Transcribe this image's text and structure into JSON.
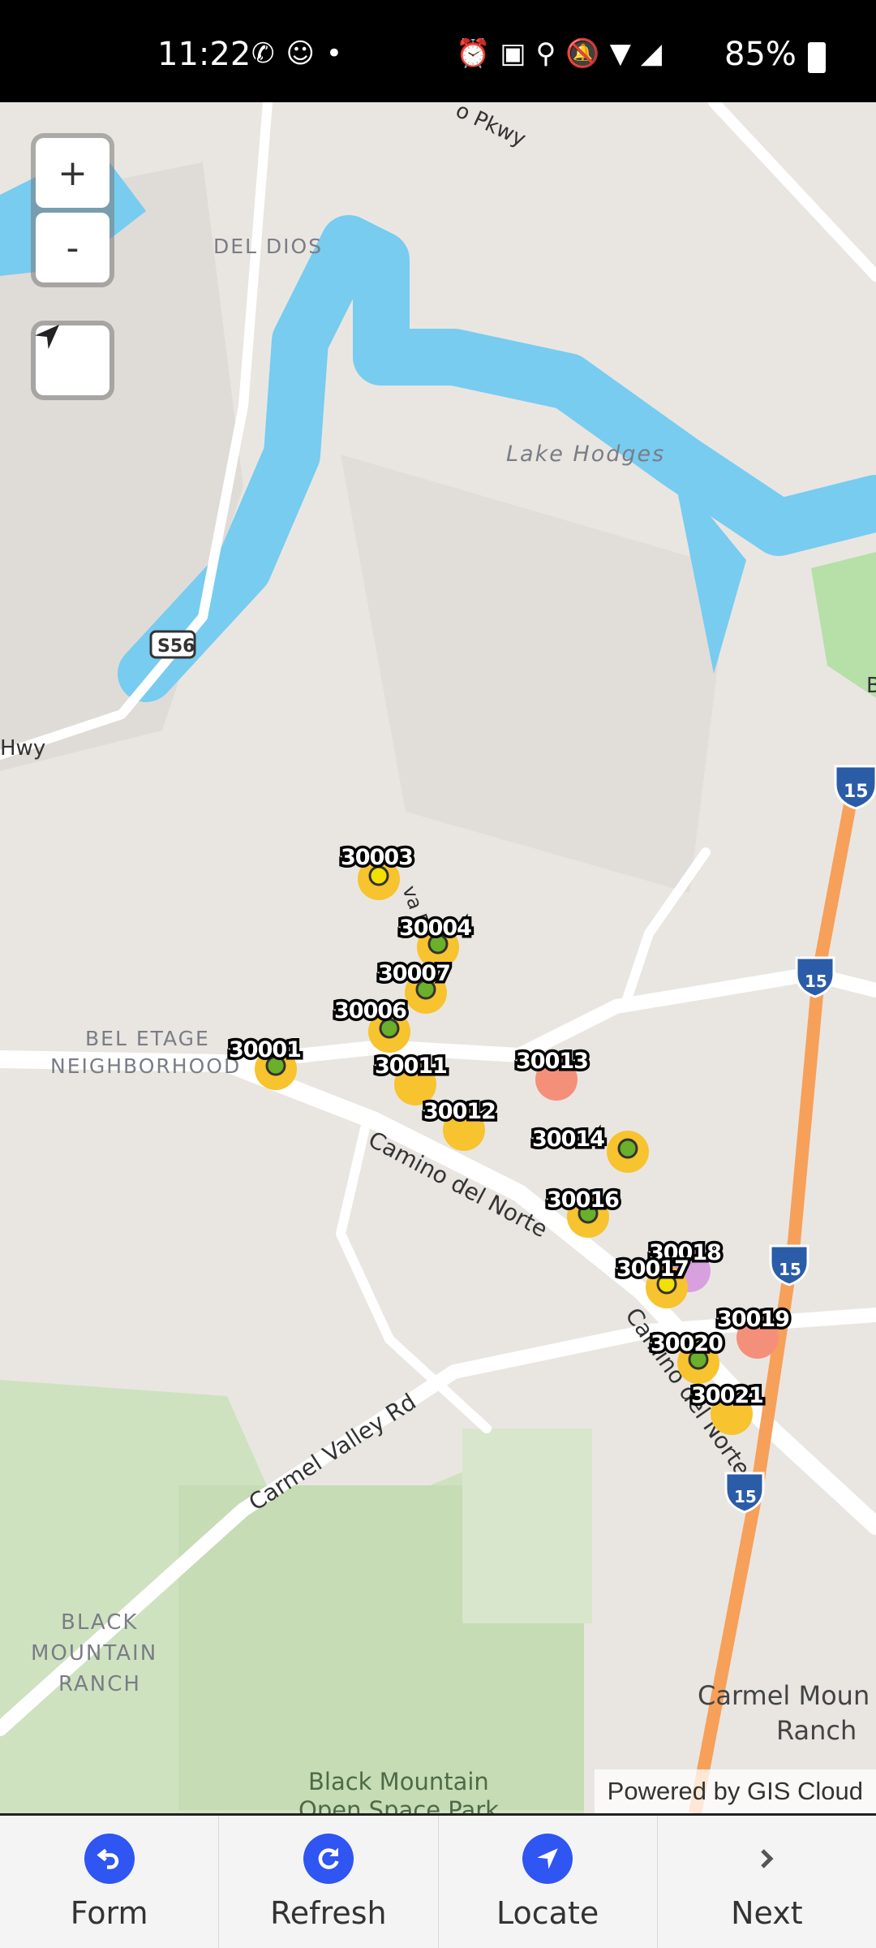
{
  "status_bar": {
    "time": "11:22",
    "left_icons": "whatsapp-icon, chat-icon, dot",
    "right_icons": "alarm, nfc, location, mute, wifi, signal",
    "battery": "85%"
  },
  "map": {
    "labels": {
      "del_dios": "DEL DIOS",
      "lake_hodges": "Lake Hodges",
      "bel_etage_1": "BEL ETAGE",
      "bel_etage_2": "NEIGHBORHOOD",
      "camino_del_norte": "Camino del Norte",
      "camino_del_norte_2": "Camino del Norte",
      "carmel_valley_rd": "Carmel Valley Rd",
      "bmr_1": "BLACK",
      "bmr_2": "MOUNTAIN",
      "bmr_3": "RANCH",
      "bmos_1": "Black Mountain",
      "bmos_2": "Open Space Park",
      "cmr_1": "Carmel Moun",
      "cmr_2": "Ranch",
      "s56": "S56",
      "i15": "15",
      "hwy": "Hwy",
      "pkwy": "o Pkwy",
      "va_rd": "va Rd",
      "b_edge": "B"
    },
    "markers": [
      {
        "id": "30003",
        "dot": "#f2e000"
      },
      {
        "id": "30004",
        "dot": "#6ab02a"
      },
      {
        "id": "30007",
        "dot": "#6ab02a"
      },
      {
        "id": "30006",
        "dot": "#6ab02a"
      },
      {
        "id": "30001",
        "dot": "#6ab02a"
      },
      {
        "id": "30011",
        "dot": null
      },
      {
        "id": "30013",
        "dot": null
      },
      {
        "id": "30012",
        "dot": null
      },
      {
        "id": "30014",
        "dot": "#6ab02a"
      },
      {
        "id": "30016",
        "dot": "#6ab02a"
      },
      {
        "id": "30018",
        "dot": null
      },
      {
        "id": "30017",
        "dot": "#f2e000"
      },
      {
        "id": "30019",
        "dot": null
      },
      {
        "id": "30020",
        "dot": "#6ab02a"
      },
      {
        "id": "30021",
        "dot": null
      }
    ],
    "zoom_in": "+",
    "zoom_out": "-",
    "attribution": "Powered by GIS Cloud"
  },
  "bottom_nav": {
    "form": "Form",
    "refresh": "Refresh",
    "locate": "Locate",
    "next": "Next"
  },
  "colors": {
    "accent": "#2f55f2",
    "parcel": "#f7c32e",
    "water": "#77ccf0",
    "highway": "#f6a05a"
  }
}
